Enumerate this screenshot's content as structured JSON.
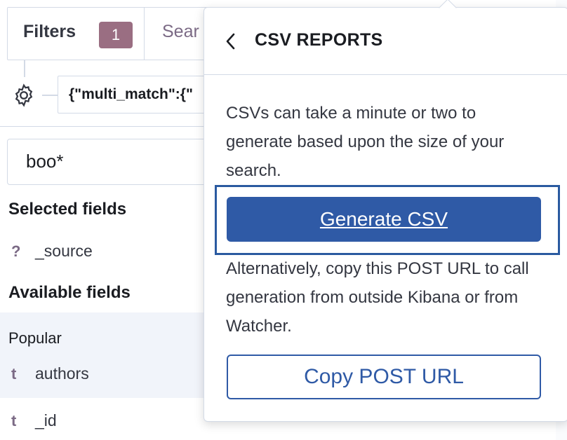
{
  "filter_bar": {
    "filters_label": "Filters",
    "filters_count": "1",
    "search_tab_label": "Sear",
    "query_text": "{\"multi_match\":{\""
  },
  "sidebar": {
    "field_search_value": "boo*",
    "selected_fields_title": "Selected fields",
    "selected_fields": [
      {
        "type": "?",
        "name": "_source"
      }
    ],
    "available_fields_title": "Available fields",
    "popular_label": "Popular",
    "popular_fields": [
      {
        "type": "t",
        "name": "authors"
      }
    ],
    "other_fields": [
      {
        "type": "t",
        "name": "_id"
      }
    ]
  },
  "csv_popover": {
    "title": "CSV REPORTS",
    "description": "CSVs can take a minute or two to generate based upon the size of your search.",
    "generate_button": "Generate CSV",
    "alternative_text": "Alternatively, copy this POST URL to call generation from outside Kibana or from Watcher.",
    "copy_button": "Copy POST URL"
  },
  "colors": {
    "primary": "#2f5aa6",
    "badge": "#9a6e82",
    "field_type": "#7b6a85",
    "border": "#d3dae6"
  },
  "icons": [
    "gear-icon",
    "chevron-left-icon"
  ]
}
